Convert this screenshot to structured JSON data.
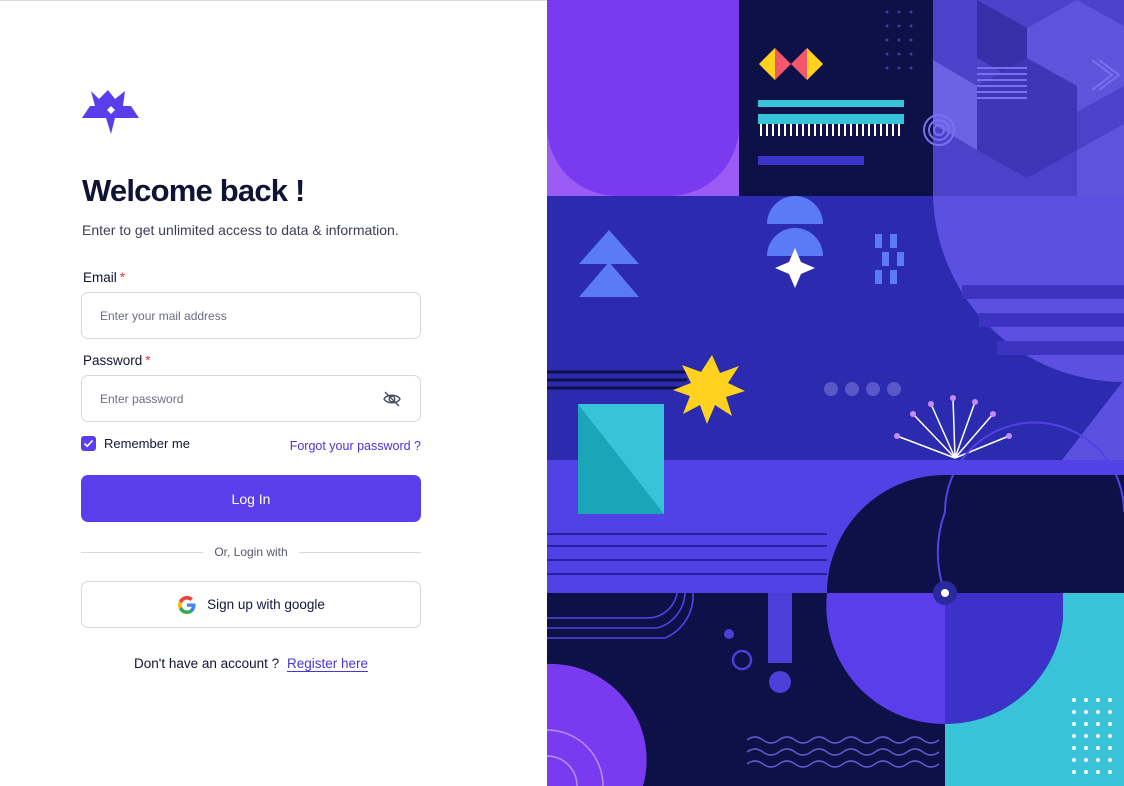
{
  "brand": {
    "logo_icon": "crown-star-logo-icon",
    "accent_color": "#5B3EEB"
  },
  "header": {
    "title": "Welcome back !",
    "subtitle": "Enter to get unlimited access to data & information."
  },
  "form": {
    "email_label": "Email",
    "required_mark": "*",
    "email_placeholder": "Enter your mail address",
    "email_value": "",
    "password_label": "Password",
    "password_placeholder": "Enter password",
    "password_value": "",
    "password_toggle_icon": "eye-off-icon",
    "remember_label": "Remember me",
    "remember_checked": true,
    "forgot_label": "Forgot your password ?",
    "login_label": "Log In",
    "divider_text": "Or, Login with",
    "google_label": "Sign up with google",
    "google_icon": "google-icon"
  },
  "footer": {
    "register_prompt": "Don't have an account ?",
    "register_link": "Register here"
  },
  "illustration": {
    "name": "geometric-pattern-illustration",
    "colors": [
      "#2B2BB3",
      "#7A3BF0",
      "#0D1147",
      "#5B4EE8",
      "#39C3D8",
      "#FFD21F",
      "#F4566B"
    ]
  }
}
